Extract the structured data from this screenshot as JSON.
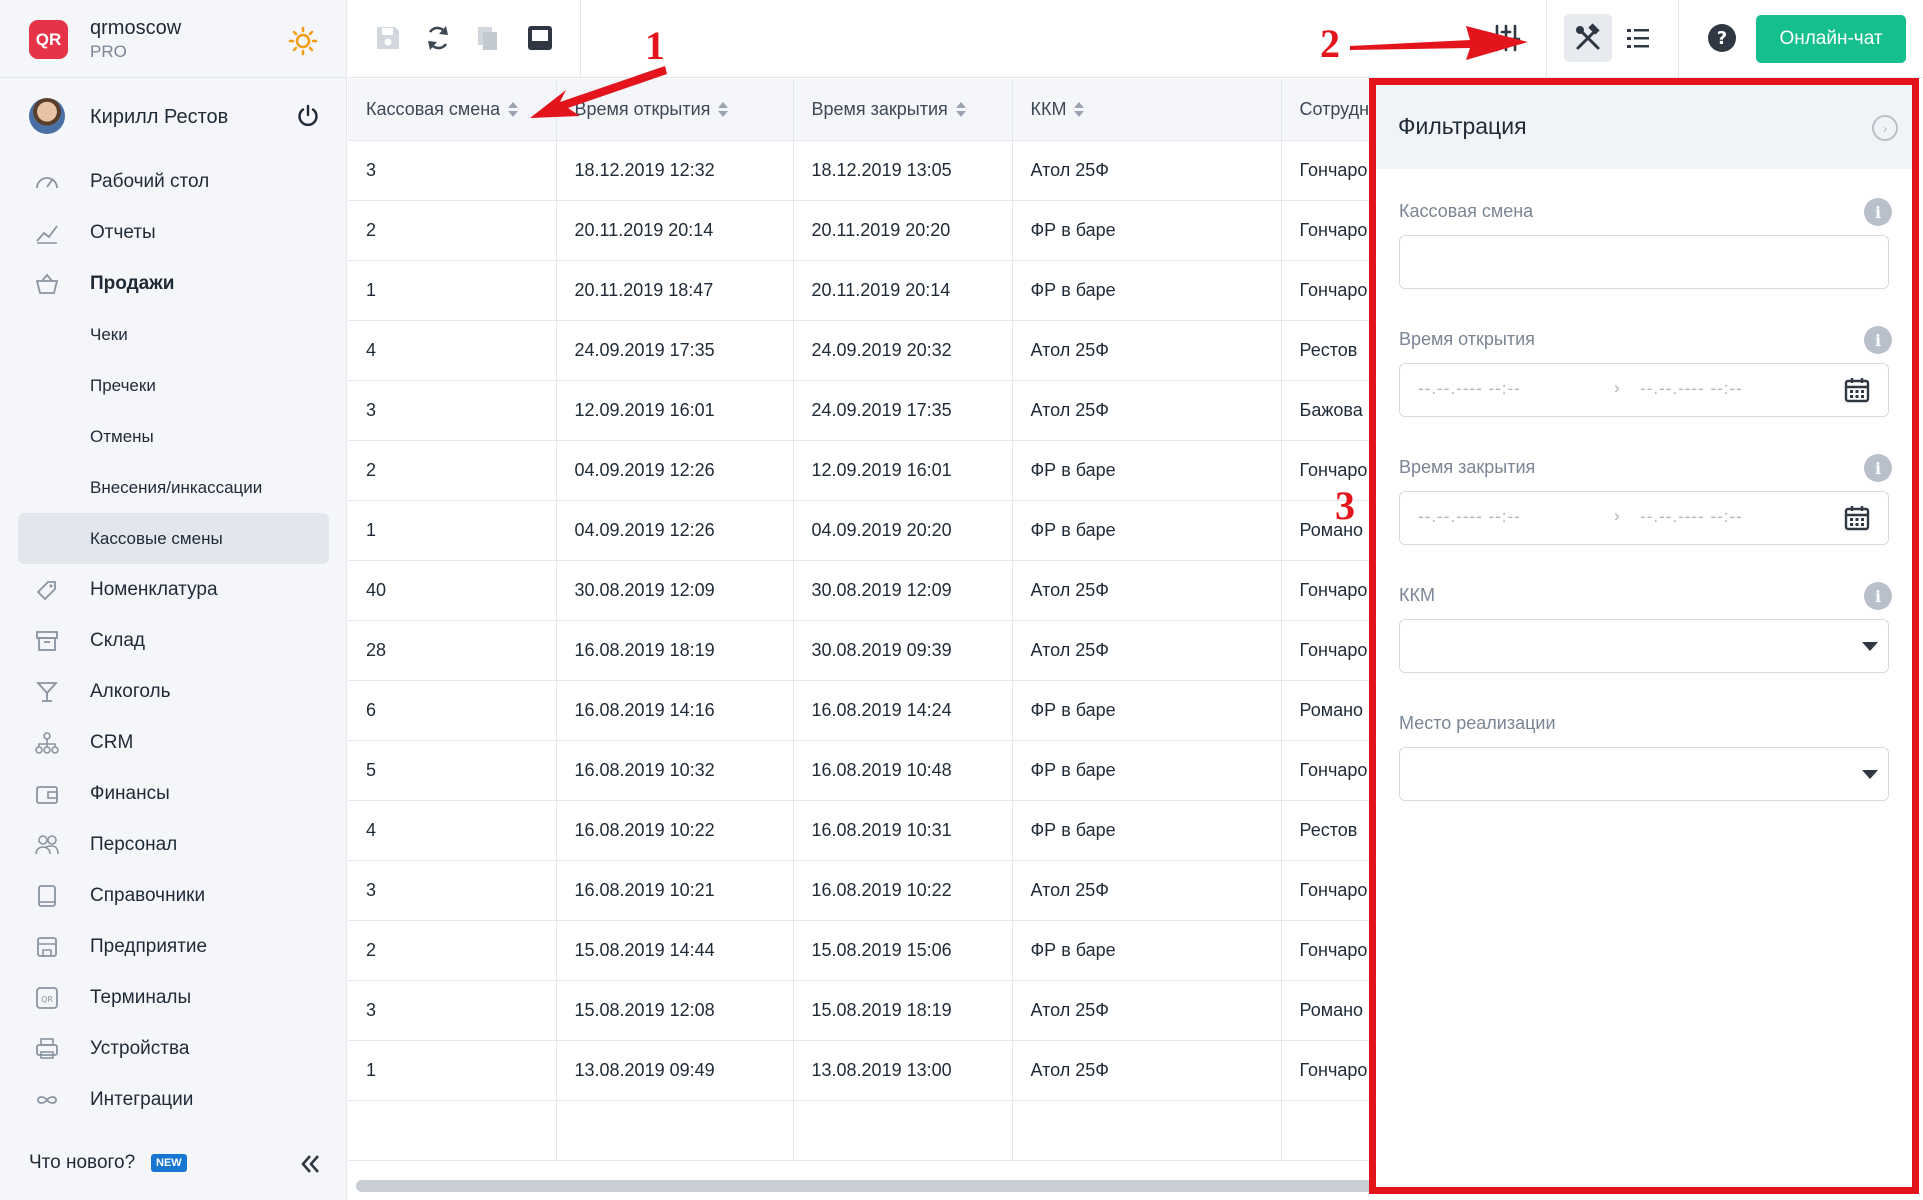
{
  "brand": {
    "name": "qrmoscow",
    "plan": "PRO",
    "logo_text": "QR"
  },
  "user": {
    "name": "Кирилл Рестов"
  },
  "nav": {
    "items": [
      {
        "label": "Рабочий стол",
        "icon": "speedometer-icon"
      },
      {
        "label": "Отчеты",
        "icon": "chart-line-icon"
      },
      {
        "label": "Продажи",
        "icon": "basket-icon",
        "bold": true
      },
      {
        "label": "Чеки",
        "sub": true
      },
      {
        "label": "Пречеки",
        "sub": true
      },
      {
        "label": "Отмены",
        "sub": true
      },
      {
        "label": "Внесения/инкассации",
        "sub": true
      },
      {
        "label": "Кассовые смены",
        "sub": true,
        "active": true
      },
      {
        "label": "Номенклатура",
        "icon": "tag-icon"
      },
      {
        "label": "Склад",
        "icon": "box-icon"
      },
      {
        "label": "Алкоголь",
        "icon": "glass-icon"
      },
      {
        "label": "CRM",
        "icon": "hierarchy-icon"
      },
      {
        "label": "Финансы",
        "icon": "wallet-icon"
      },
      {
        "label": "Персонал",
        "icon": "people-icon"
      },
      {
        "label": "Справочники",
        "icon": "book-icon"
      },
      {
        "label": "Предприятие",
        "icon": "store-icon"
      },
      {
        "label": "Терминалы",
        "icon": "qr-terminal-icon"
      },
      {
        "label": "Устройства",
        "icon": "printer-icon"
      },
      {
        "label": "Интеграции",
        "icon": "infinity-icon"
      }
    ],
    "whatsnew": "Что нового?",
    "new_badge": "NEW"
  },
  "toolbar": {
    "chat_label": "Онлайн-чат"
  },
  "table": {
    "columns": [
      "Кассовая смена",
      "Время открытия",
      "Время закрытия",
      "ККМ",
      "Сотрудн"
    ],
    "rows": [
      [
        "3",
        "18.12.2019 12:32",
        "18.12.2019 13:05",
        "Атол 25Ф",
        "Гончаро"
      ],
      [
        "2",
        "20.11.2019 20:14",
        "20.11.2019 20:20",
        "ФР в баре",
        "Гончаро"
      ],
      [
        "1",
        "20.11.2019 18:47",
        "20.11.2019 20:14",
        "ФР в баре",
        "Гончаро"
      ],
      [
        "4",
        "24.09.2019 17:35",
        "24.09.2019 20:32",
        "Атол 25Ф",
        "Рестов"
      ],
      [
        "3",
        "12.09.2019 16:01",
        "24.09.2019 17:35",
        "Атол 25Ф",
        "Бажова"
      ],
      [
        "2",
        "04.09.2019 12:26",
        "12.09.2019 16:01",
        "ФР в баре",
        "Гончаро"
      ],
      [
        "1",
        "04.09.2019 12:26",
        "04.09.2019 20:20",
        "ФР в баре",
        "Романо"
      ],
      [
        "40",
        "30.08.2019 12:09",
        "30.08.2019 12:09",
        "Атол 25Ф",
        "Гончаро"
      ],
      [
        "28",
        "16.08.2019 18:19",
        "30.08.2019 09:39",
        "Атол 25Ф",
        "Гончаро"
      ],
      [
        "6",
        "16.08.2019 14:16",
        "16.08.2019 14:24",
        "ФР в баре",
        "Романо"
      ],
      [
        "5",
        "16.08.2019 10:32",
        "16.08.2019 10:48",
        "ФР в баре",
        "Гончаро"
      ],
      [
        "4",
        "16.08.2019 10:22",
        "16.08.2019 10:31",
        "ФР в баре",
        "Рестов"
      ],
      [
        "3",
        "16.08.2019 10:21",
        "16.08.2019 10:22",
        "Атол 25Ф",
        "Гончаро"
      ],
      [
        "2",
        "15.08.2019 14:44",
        "15.08.2019 15:06",
        "ФР в баре",
        "Гончаро"
      ],
      [
        "3",
        "15.08.2019 12:08",
        "15.08.2019 18:19",
        "Атол 25Ф",
        "Романо"
      ],
      [
        "1",
        "13.08.2019 09:49",
        "13.08.2019 13:00",
        "Атол 25Ф",
        "Гончаро"
      ]
    ]
  },
  "filter": {
    "title": "Фильтрация",
    "shift_label": "Кассовая смена",
    "open_label": "Время открытия",
    "close_label": "Время закрытия",
    "kkm_label": "ККМ",
    "place_label": "Место реализации",
    "date_placeholder": "--.--.---- --:--",
    "range_arrow": "›"
  },
  "annotations": {
    "a1": "1",
    "a2": "2",
    "a3": "3"
  },
  "colors": {
    "accent_green": "#16c08e",
    "annotation_red": "#e4141c",
    "logo_red": "#e63347"
  }
}
